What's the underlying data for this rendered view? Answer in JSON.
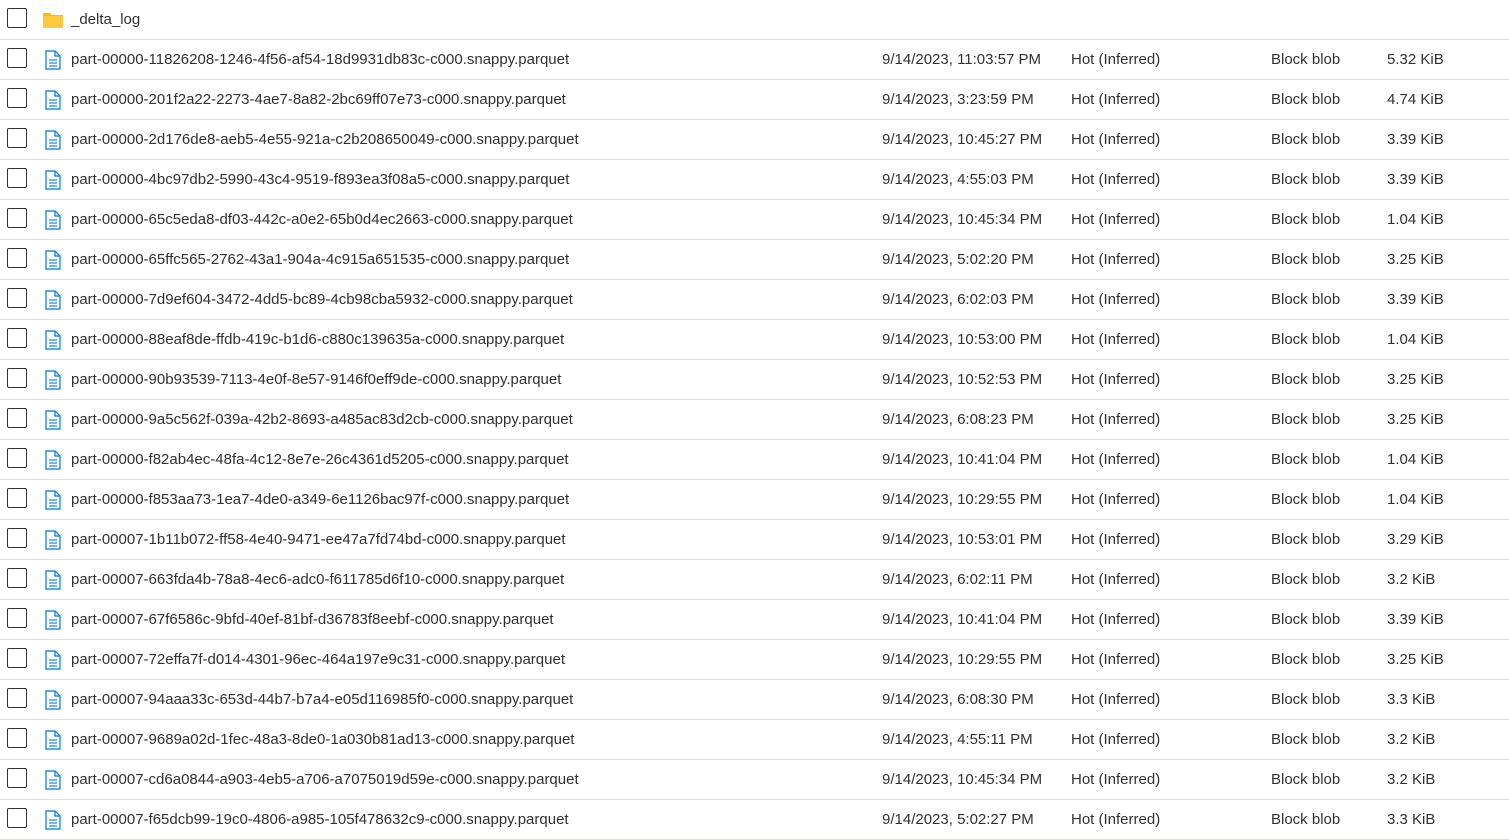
{
  "folder": {
    "name": "_delta_log",
    "icon": "folder-icon",
    "icon_color": "#ffb900"
  },
  "file_icon": "file-icon",
  "file_icon_color": "#0078d4",
  "files": [
    {
      "name": "part-00000-11826208-1246-4f56-af54-18d9931db83c-c000.snappy.parquet",
      "modified": "9/14/2023, 11:03:57 PM",
      "tier": "Hot (Inferred)",
      "type": "Block blob",
      "size": "5.32 KiB"
    },
    {
      "name": "part-00000-201f2a22-2273-4ae7-8a82-2bc69ff07e73-c000.snappy.parquet",
      "modified": "9/14/2023, 3:23:59 PM",
      "tier": "Hot (Inferred)",
      "type": "Block blob",
      "size": "4.74 KiB"
    },
    {
      "name": "part-00000-2d176de8-aeb5-4e55-921a-c2b208650049-c000.snappy.parquet",
      "modified": "9/14/2023, 10:45:27 PM",
      "tier": "Hot (Inferred)",
      "type": "Block blob",
      "size": "3.39 KiB"
    },
    {
      "name": "part-00000-4bc97db2-5990-43c4-9519-f893ea3f08a5-c000.snappy.parquet",
      "modified": "9/14/2023, 4:55:03 PM",
      "tier": "Hot (Inferred)",
      "type": "Block blob",
      "size": "3.39 KiB"
    },
    {
      "name": "part-00000-65c5eda8-df03-442c-a0e2-65b0d4ec2663-c000.snappy.parquet",
      "modified": "9/14/2023, 10:45:34 PM",
      "tier": "Hot (Inferred)",
      "type": "Block blob",
      "size": "1.04 KiB"
    },
    {
      "name": "part-00000-65ffc565-2762-43a1-904a-4c915a651535-c000.snappy.parquet",
      "modified": "9/14/2023, 5:02:20 PM",
      "tier": "Hot (Inferred)",
      "type": "Block blob",
      "size": "3.25 KiB"
    },
    {
      "name": "part-00000-7d9ef604-3472-4dd5-bc89-4cb98cba5932-c000.snappy.parquet",
      "modified": "9/14/2023, 6:02:03 PM",
      "tier": "Hot (Inferred)",
      "type": "Block blob",
      "size": "3.39 KiB"
    },
    {
      "name": "part-00000-88eaf8de-ffdb-419c-b1d6-c880c139635a-c000.snappy.parquet",
      "modified": "9/14/2023, 10:53:00 PM",
      "tier": "Hot (Inferred)",
      "type": "Block blob",
      "size": "1.04 KiB"
    },
    {
      "name": "part-00000-90b93539-7113-4e0f-8e57-9146f0eff9de-c000.snappy.parquet",
      "modified": "9/14/2023, 10:52:53 PM",
      "tier": "Hot (Inferred)",
      "type": "Block blob",
      "size": "3.25 KiB"
    },
    {
      "name": "part-00000-9a5c562f-039a-42b2-8693-a485ac83d2cb-c000.snappy.parquet",
      "modified": "9/14/2023, 6:08:23 PM",
      "tier": "Hot (Inferred)",
      "type": "Block blob",
      "size": "3.25 KiB"
    },
    {
      "name": "part-00000-f82ab4ec-48fa-4c12-8e7e-26c4361d5205-c000.snappy.parquet",
      "modified": "9/14/2023, 10:41:04 PM",
      "tier": "Hot (Inferred)",
      "type": "Block blob",
      "size": "1.04 KiB"
    },
    {
      "name": "part-00000-f853aa73-1ea7-4de0-a349-6e1126bac97f-c000.snappy.parquet",
      "modified": "9/14/2023, 10:29:55 PM",
      "tier": "Hot (Inferred)",
      "type": "Block blob",
      "size": "1.04 KiB"
    },
    {
      "name": "part-00007-1b11b072-ff58-4e40-9471-ee47a7fd74bd-c000.snappy.parquet",
      "modified": "9/14/2023, 10:53:01 PM",
      "tier": "Hot (Inferred)",
      "type": "Block blob",
      "size": "3.29 KiB"
    },
    {
      "name": "part-00007-663fda4b-78a8-4ec6-adc0-f611785d6f10-c000.snappy.parquet",
      "modified": "9/14/2023, 6:02:11 PM",
      "tier": "Hot (Inferred)",
      "type": "Block blob",
      "size": "3.2 KiB"
    },
    {
      "name": "part-00007-67f6586c-9bfd-40ef-81bf-d36783f8eebf-c000.snappy.parquet",
      "modified": "9/14/2023, 10:41:04 PM",
      "tier": "Hot (Inferred)",
      "type": "Block blob",
      "size": "3.39 KiB"
    },
    {
      "name": "part-00007-72effa7f-d014-4301-96ec-464a197e9c31-c000.snappy.parquet",
      "modified": "9/14/2023, 10:29:55 PM",
      "tier": "Hot (Inferred)",
      "type": "Block blob",
      "size": "3.25 KiB"
    },
    {
      "name": "part-00007-94aaa33c-653d-44b7-b7a4-e05d116985f0-c000.snappy.parquet",
      "modified": "9/14/2023, 6:08:30 PM",
      "tier": "Hot (Inferred)",
      "type": "Block blob",
      "size": "3.3 KiB"
    },
    {
      "name": "part-00007-9689a02d-1fec-48a3-8de0-1a030b81ad13-c000.snappy.parquet",
      "modified": "9/14/2023, 4:55:11 PM",
      "tier": "Hot (Inferred)",
      "type": "Block blob",
      "size": "3.2 KiB"
    },
    {
      "name": "part-00007-cd6a0844-a903-4eb5-a706-a7075019d59e-c000.snappy.parquet",
      "modified": "9/14/2023, 10:45:34 PM",
      "tier": "Hot (Inferred)",
      "type": "Block blob",
      "size": "3.2 KiB"
    },
    {
      "name": "part-00007-f65dcb99-19c0-4806-a985-105f478632c9-c000.snappy.parquet",
      "modified": "9/14/2023, 5:02:27 PM",
      "tier": "Hot (Inferred)",
      "type": "Block blob",
      "size": "3.3 KiB"
    }
  ]
}
